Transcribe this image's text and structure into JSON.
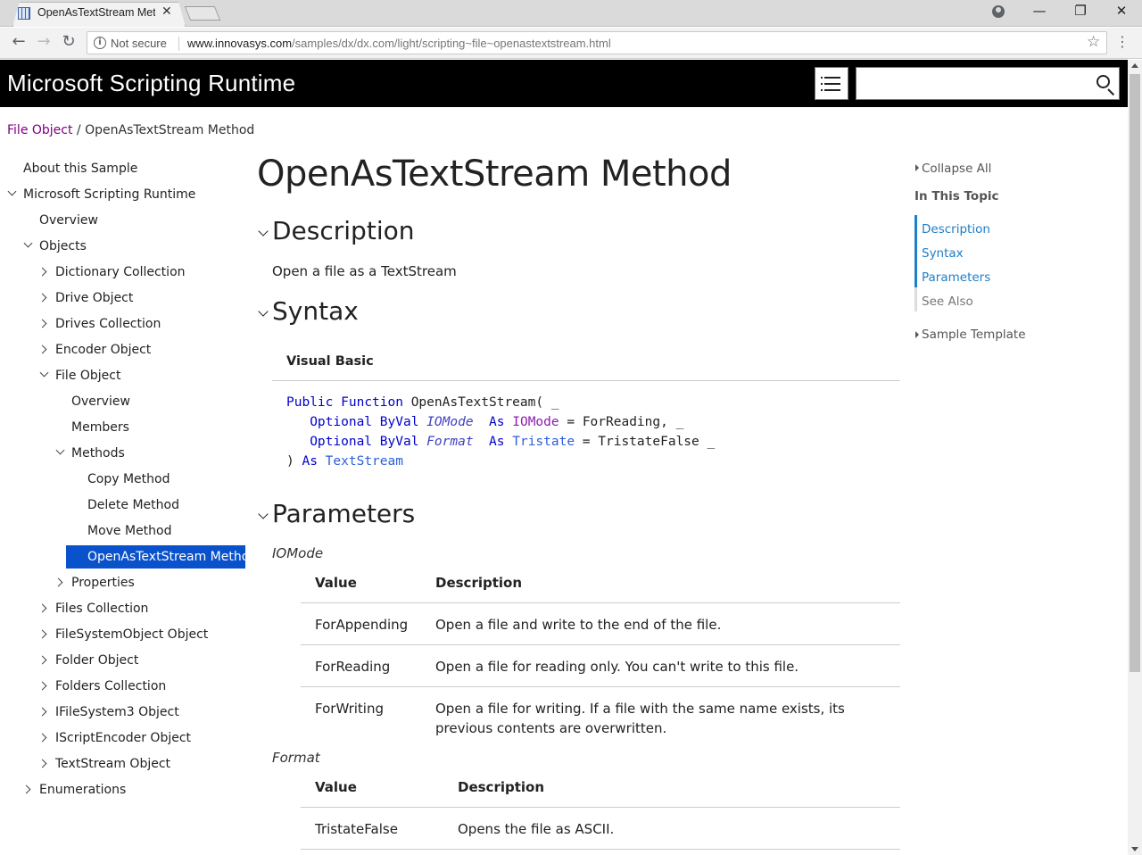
{
  "browser": {
    "tab_title": "OpenAsTextStream Meth",
    "tab_close": "✕",
    "not_secure": "Not secure",
    "url_host": "www.innovasys.com",
    "url_path": "/samples/dx/dx.com/light/scripting~file~openastextstream.html",
    "back": "←",
    "forward": "→",
    "reload": "↻",
    "star": "☆",
    "kebab": "⋮",
    "minimize": "—",
    "restore": "❐",
    "close": "✕"
  },
  "header": {
    "site_title": "Microsoft Scripting Runtime"
  },
  "breadcrumb": {
    "link": "File Object",
    "separator": " / ",
    "current": "OpenAsTextStream Method"
  },
  "tree": [
    {
      "label": "About this Sample",
      "name": "tree-item-about-this-sample",
      "chev": ""
    },
    {
      "label": "Microsoft Scripting Runtime",
      "name": "tree-item-microsoft-scripting-runtime",
      "chev": "down"
    },
    {
      "label": "Overview",
      "name": "tree-item-overview",
      "chev": ""
    },
    {
      "label": "Objects",
      "name": "tree-item-objects",
      "chev": "down"
    },
    {
      "label": "Dictionary Collection",
      "name": "tree-item-dictionary-collection",
      "chev": "right"
    },
    {
      "label": "Drive Object",
      "name": "tree-item-drive-object",
      "chev": "right"
    },
    {
      "label": "Drives Collection",
      "name": "tree-item-drives-collection",
      "chev": "right"
    },
    {
      "label": "Encoder Object",
      "name": "tree-item-encoder-object",
      "chev": "right"
    },
    {
      "label": "File Object",
      "name": "tree-item-file-object",
      "chev": "down"
    },
    {
      "label": "Overview",
      "name": "tree-item-file-overview",
      "chev": ""
    },
    {
      "label": "Members",
      "name": "tree-item-members",
      "chev": ""
    },
    {
      "label": "Methods",
      "name": "tree-item-methods",
      "chev": "down"
    },
    {
      "label": "Copy Method",
      "name": "tree-item-copy-method",
      "chev": ""
    },
    {
      "label": "Delete Method",
      "name": "tree-item-delete-method",
      "chev": ""
    },
    {
      "label": "Move Method",
      "name": "tree-item-move-method",
      "chev": ""
    },
    {
      "label": "OpenAsTextStream Method",
      "name": "tree-item-openastextstream-method",
      "chev": "",
      "selected": true
    },
    {
      "label": "Properties",
      "name": "tree-item-properties",
      "chev": "right"
    },
    {
      "label": "Files Collection",
      "name": "tree-item-files-collection",
      "chev": "right"
    },
    {
      "label": "FileSystemObject Object",
      "name": "tree-item-filesystemobject-object",
      "chev": "right"
    },
    {
      "label": "Folder Object",
      "name": "tree-item-folder-object",
      "chev": "right"
    },
    {
      "label": "Folders Collection",
      "name": "tree-item-folders-collection",
      "chev": "right"
    },
    {
      "label": "IFileSystem3 Object",
      "name": "tree-item-ifilesystem3-object",
      "chev": "right"
    },
    {
      "label": "IScriptEncoder Object",
      "name": "tree-item-iscriptencoder-object",
      "chev": "right"
    },
    {
      "label": "TextStream Object",
      "name": "tree-item-textstream-object",
      "chev": "right"
    },
    {
      "label": "Enumerations",
      "name": "tree-item-enumerations",
      "chev": "right"
    }
  ],
  "main": {
    "title": "OpenAsTextStream Method",
    "description_heading": "Description",
    "description_text": "Open a file as a TextStream",
    "syntax_heading": "Syntax",
    "code_language": "Visual Basic",
    "parameters_heading": "Parameters",
    "code": {
      "l1_kw1": "Public",
      "l1_kw2": "Function",
      "l1_rest": " OpenAsTextStream( _",
      "l2_kw1": "Optional",
      "l2_kw2": "ByVal",
      "l2_param": "IOMode",
      "l2_as": "As",
      "l2_type": "IOMode",
      "l2_rest": " = ForReading, _",
      "l3_kw1": "Optional",
      "l3_kw2": "ByVal",
      "l3_param": "Format",
      "l3_as": "As",
      "l3_type": "Tristate",
      "l3_rest": " = TristateFalse _",
      "l4_open": ") ",
      "l4_as": "As",
      "l4_type": "TextStream"
    },
    "params": [
      {
        "name": "IOMode",
        "col_value": "Value",
        "col_desc": "Description",
        "rows": [
          {
            "value": "ForAppending",
            "desc": "Open a file and write to the end of the file."
          },
          {
            "value": "ForReading",
            "desc": "Open a file for reading only. You can't write to this file."
          },
          {
            "value": "ForWriting",
            "desc": "Open a file for writing. If a file with the same name exists, its previous contents are overwritten."
          }
        ]
      },
      {
        "name": "Format",
        "col_value": "Value",
        "col_desc": "Description",
        "rows": [
          {
            "value": "TristateFalse",
            "desc": "Opens the file as ASCII."
          }
        ]
      }
    ]
  },
  "toc": {
    "collapse_all": "Collapse All",
    "in_this_topic": "In This Topic",
    "links": [
      "Description",
      "Syntax",
      "Parameters",
      "See Also"
    ],
    "sample_template": "Sample Template",
    "link_color": "#1e7ec8",
    "muted_color": "#777777"
  }
}
